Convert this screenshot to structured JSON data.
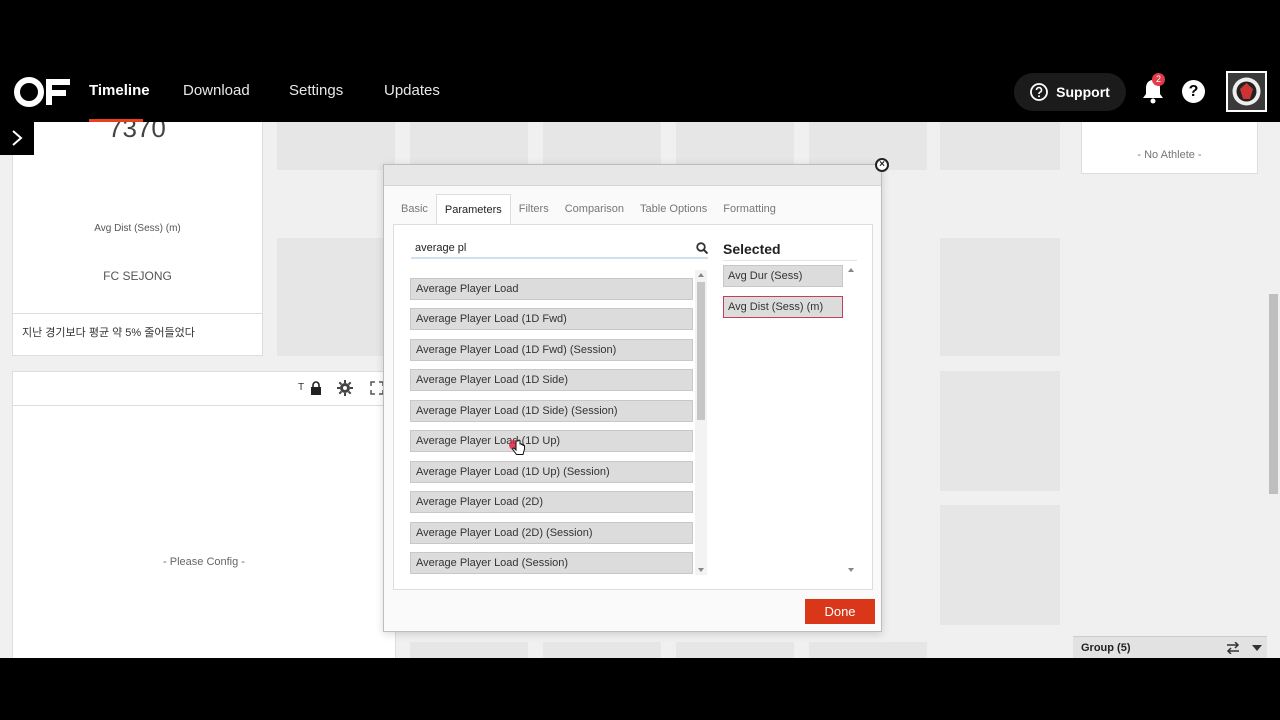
{
  "nav": {
    "links": [
      {
        "label": "Timeline",
        "active": true
      },
      {
        "label": "Download",
        "active": false
      },
      {
        "label": "Settings",
        "active": false
      },
      {
        "label": "Updates",
        "active": false
      }
    ],
    "support_label": "Support",
    "notification_count": "2",
    "help_label": "?",
    "accent_color": "#e8401c"
  },
  "cards": {
    "big_number": "7370",
    "metric_label": "Avg Dist (Sess) (m)",
    "team": "FC SEJONG",
    "footnote": "지난 경기보다 평균 약 5% 줄어들었다",
    "toolbar_text": "T",
    "please_config": "- Please Config -"
  },
  "right_panel": {
    "no_athlete": "- No Athlete -",
    "group_label": "Group (5)"
  },
  "modal": {
    "tabs": [
      {
        "label": "Basic",
        "active": false
      },
      {
        "label": "Parameters",
        "active": true
      },
      {
        "label": "Filters",
        "active": false
      },
      {
        "label": "Comparison",
        "active": false
      },
      {
        "label": "Table Options",
        "active": false
      },
      {
        "label": "Formatting",
        "active": false
      }
    ],
    "search_value": "average pl",
    "results": [
      "Average Player Load",
      "Average Player Load (1D Fwd)",
      "Average Player Load (1D Fwd) (Session)",
      "Average Player Load (1D Side)",
      "Average Player Load (1D Side) (Session)",
      "Average Player Load (1D Up)",
      "Average Player Load (1D Up) (Session)",
      "Average Player Load (2D)",
      "Average Player Load (2D) (Session)",
      "Average Player Load (Session)"
    ],
    "selected_title": "Selected",
    "selected": [
      "Avg Dur (Sess)",
      "Avg Dist (Sess) (m)"
    ],
    "done_label": "Done",
    "done_color": "#d9361a"
  }
}
